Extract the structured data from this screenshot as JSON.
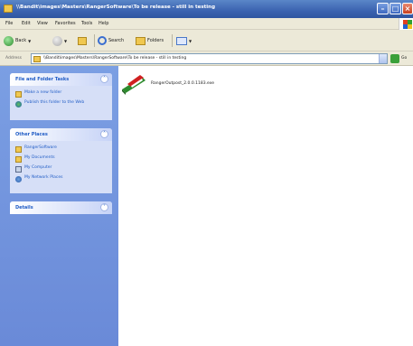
{
  "window": {
    "title": "\\\\Bandit\\images\\Masters\\RangerSoftware\\To be release - still in testing"
  },
  "menu": [
    "File",
    "Edit",
    "View",
    "Favorites",
    "Tools",
    "Help"
  ],
  "toolbar": {
    "back": "Back",
    "search": "Search",
    "folders": "Folders"
  },
  "address": {
    "label": "Address",
    "value": "\\\\Bandit\\images\\Masters\\RangerSoftware\\To be release - still in testing",
    "go": "Go"
  },
  "sidebar": {
    "file_folder_tasks": {
      "title": "File and Folder Tasks",
      "items": [
        {
          "label": "Make a new folder",
          "icon": "new-folder-icon"
        },
        {
          "label": "Publish this folder to the Web",
          "icon": "publish-web-icon"
        }
      ]
    },
    "other_places": {
      "title": "Other Places",
      "items": [
        {
          "label": "RangerSoftware",
          "icon": "folder-icon"
        },
        {
          "label": "My Documents",
          "icon": "my-documents-icon"
        },
        {
          "label": "My Computer",
          "icon": "my-computer-icon"
        },
        {
          "label": "My Network Places",
          "icon": "network-places-icon"
        }
      ]
    },
    "details": {
      "title": "Details"
    }
  },
  "files": [
    {
      "name": "RangerOutpost_2.0.0.1183.exe",
      "icon": "installer-exe-icon"
    }
  ],
  "colors": {
    "title_bar": "#3b63b0",
    "sidebar_bg": "#7b9fe3",
    "task_link": "#215dc6"
  }
}
